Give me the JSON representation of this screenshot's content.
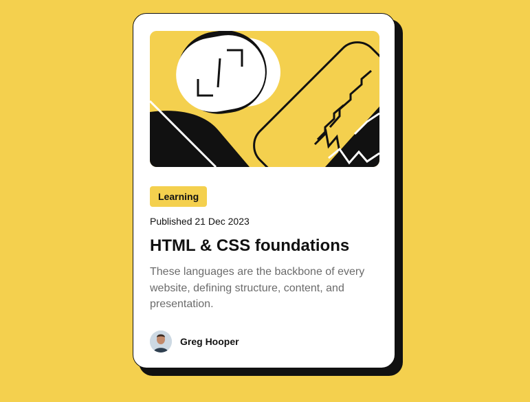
{
  "card": {
    "hero_image": "illustration-article-icon",
    "category_tag": "Learning",
    "published": "Published 21 Dec 2023",
    "title": "HTML & CSS foundations",
    "description": "These languages are the backbone of every website, defining structure, content, and presentation.",
    "author": {
      "name": "Greg Hooper",
      "avatar": "avatar-icon"
    }
  },
  "colors": {
    "background": "#f4d04e",
    "card": "#ffffff",
    "text": "#111111",
    "muted_text": "#6b6b6b",
    "tag": "#f4d04e",
    "shadow": "#111111"
  }
}
